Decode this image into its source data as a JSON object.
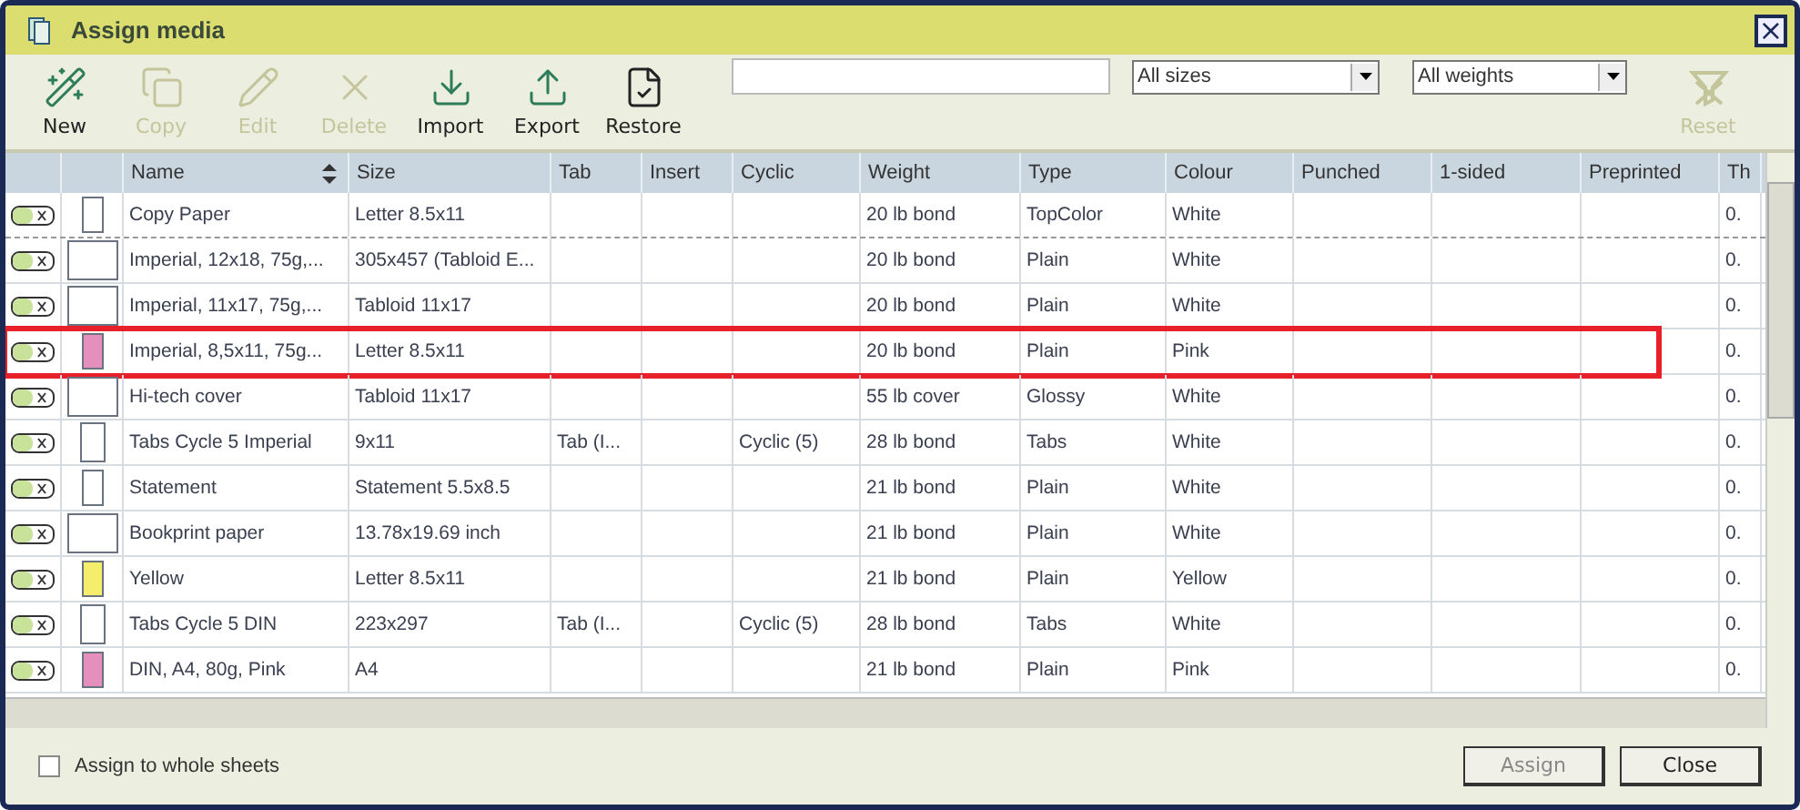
{
  "window": {
    "title": "Assign media",
    "close": "×"
  },
  "toolbar": [
    {
      "label": "New",
      "kind": "new",
      "disabled": false
    },
    {
      "label": "Copy",
      "kind": "copy",
      "disabled": true
    },
    {
      "label": "Edit",
      "kind": "edit",
      "disabled": true
    },
    {
      "label": "Delete",
      "kind": "delete",
      "disabled": true
    },
    {
      "label": "Import",
      "kind": "import",
      "disabled": false
    },
    {
      "label": "Export",
      "kind": "export",
      "disabled": false
    },
    {
      "label": "Restore",
      "kind": "restore",
      "disabled": false
    }
  ],
  "filters": {
    "size": "All sizes",
    "weight": "All weights",
    "reset": {
      "label": "Reset",
      "disabled": true
    }
  },
  "table": {
    "columns": [
      "Name",
      "Size",
      "Tab",
      "Insert",
      "Cyclic",
      "Weight",
      "Type",
      "Colour",
      "Punched",
      "1-sided",
      "Preprinted",
      "Th"
    ],
    "rows": [
      {
        "sheet": {
          "kind": "portrait",
          "color": "#ffffff"
        },
        "cells": [
          "Copy Paper",
          "Letter 8.5x11",
          "",
          "",
          "",
          "20 lb bond",
          "TopColor",
          "White",
          "",
          "",
          "",
          "0."
        ],
        "highlighted": false
      },
      {
        "sheet": {
          "kind": "landscape",
          "color": "#ffffff"
        },
        "cells": [
          "Imperial, 12x18, 75g,...",
          "305x457 (Tabloid E...",
          "",
          "",
          "",
          "20 lb bond",
          "Plain",
          "White",
          "",
          "",
          "",
          "0."
        ],
        "highlighted": false
      },
      {
        "sheet": {
          "kind": "landscape",
          "color": "#ffffff"
        },
        "cells": [
          "Imperial, 11x17, 75g,...",
          "Tabloid 11x17",
          "",
          "",
          "",
          "20 lb bond",
          "Plain",
          "White",
          "",
          "",
          "",
          "0."
        ],
        "highlighted": false
      },
      {
        "sheet": {
          "kind": "portrait",
          "color": "#e58fbd"
        },
        "cells": [
          "Imperial, 8,5x11, 75g...",
          "Letter 8.5x11",
          "",
          "",
          "",
          "20 lb bond",
          "Plain",
          "Pink",
          "",
          "",
          "",
          "0."
        ],
        "highlighted": true
      },
      {
        "sheet": {
          "kind": "landscape",
          "color": "#ffffff"
        },
        "cells": [
          "Hi-tech cover",
          "Tabloid 11x17",
          "",
          "",
          "",
          "55 lb cover",
          "Glossy",
          "White",
          "",
          "",
          "",
          "0."
        ],
        "highlighted": false
      },
      {
        "sheet": {
          "kind": "tab",
          "color": "#ffffff"
        },
        "cells": [
          "Tabs Cycle 5 Imperial",
          "9x11",
          "Tab (I...",
          "",
          "Cyclic (5)",
          "28 lb bond",
          "Tabs",
          "White",
          "",
          "",
          "",
          "0."
        ],
        "highlighted": false
      },
      {
        "sheet": {
          "kind": "portrait",
          "color": "#ffffff"
        },
        "cells": [
          "Statement",
          "Statement 5.5x8.5",
          "",
          "",
          "",
          "21 lb bond",
          "Plain",
          "White",
          "",
          "",
          "",
          "0."
        ],
        "highlighted": false
      },
      {
        "sheet": {
          "kind": "landscape",
          "color": "#ffffff"
        },
        "cells": [
          "Bookprint paper",
          "13.78x19.69 inch",
          "",
          "",
          "",
          "21 lb bond",
          "Plain",
          "White",
          "",
          "",
          "",
          "0."
        ],
        "highlighted": false
      },
      {
        "sheet": {
          "kind": "portrait",
          "color": "#f5ee6a"
        },
        "cells": [
          "Yellow",
          "Letter 8.5x11",
          "",
          "",
          "",
          "21 lb bond",
          "Plain",
          "Yellow",
          "",
          "",
          "",
          "0."
        ],
        "highlighted": false
      },
      {
        "sheet": {
          "kind": "tab",
          "color": "#ffffff"
        },
        "cells": [
          "Tabs Cycle 5  DIN",
          "223x297",
          "Tab (I...",
          "",
          "Cyclic (5)",
          "28 lb bond",
          "Tabs",
          "White",
          "",
          "",
          "",
          "0."
        ],
        "highlighted": false
      },
      {
        "sheet": {
          "kind": "portrait",
          "color": "#e58fbd"
        },
        "cells": [
          "DIN, A4, 80g, Pink",
          "A4",
          "",
          "",
          "",
          "21 lb bond",
          "Plain",
          "Pink",
          "",
          "",
          "",
          "0."
        ],
        "highlighted": false
      }
    ]
  },
  "footer": {
    "checkbox": {
      "label": "Assign to whole sheets",
      "checked": false
    },
    "buttons": [
      {
        "label": "Assign",
        "disabled": true
      },
      {
        "label": "Close",
        "disabled": false
      }
    ]
  }
}
